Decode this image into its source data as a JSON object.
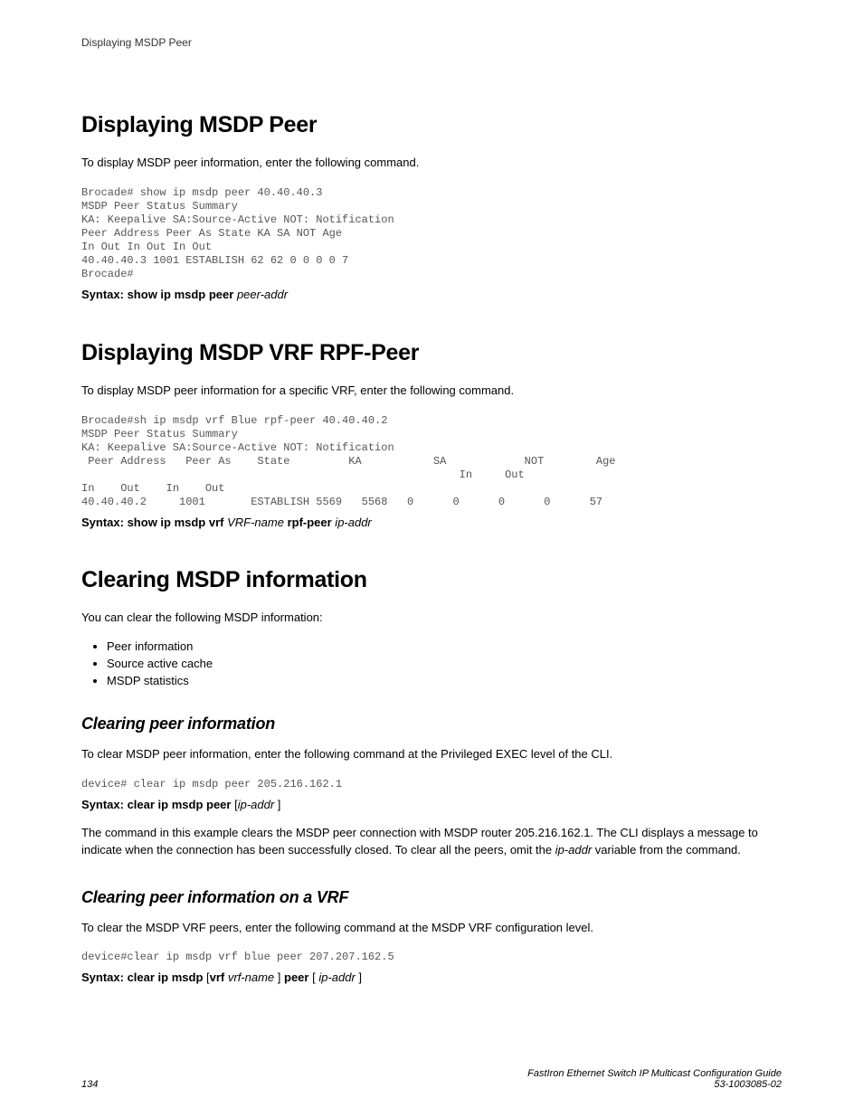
{
  "header": {
    "running": "Displaying MSDP Peer"
  },
  "sec1": {
    "title": "Displaying MSDP Peer",
    "intro": "To display MSDP peer information, enter the following command.",
    "code": "Brocade# show ip msdp peer 40.40.40.3\nMSDP Peer Status Summary\nKA: Keepalive SA:Source-Active NOT: Notification\nPeer Address Peer As State KA SA NOT Age\nIn Out In Out In Out\n40.40.40.3 1001 ESTABLISH 62 62 0 0 0 0 7\nBrocade#",
    "syntax_label": "Syntax: ",
    "syntax_cmd": "show ip msdp peer",
    "syntax_arg": " peer-addr"
  },
  "sec2": {
    "title": "Displaying MSDP VRF RPF-Peer",
    "intro": "To display MSDP peer information for a specific VRF, enter the following command.",
    "code": "Brocade#sh ip msdp vrf Blue rpf-peer 40.40.40.2\nMSDP Peer Status Summary\nKA: Keepalive SA:Source-Active NOT: Notification\n Peer Address   Peer As    State         KA           SA            NOT        Age\n                                                          In     Out\nIn    Out    In    Out\n40.40.40.2     1001       ESTABLISH 5569   5568   0      0      0      0      57",
    "syntax_label": "Syntax: ",
    "syntax_cmd_a": "show ip msdp vrf",
    "syntax_arg_a": " VRF-name",
    "syntax_cmd_b": " rpf-peer",
    "syntax_arg_b": " ip-addr"
  },
  "sec3": {
    "title": "Clearing MSDP information",
    "intro": "You can clear the following MSDP information:",
    "bullets": [
      "Peer information",
      "Source active cache",
      "MSDP statistics"
    ],
    "sub1": {
      "title": "Clearing peer information",
      "intro": "To clear MSDP peer information, enter the following command at the Privileged EXEC level of the CLI.",
      "code": "device# clear ip msdp peer 205.216.162.1",
      "syntax_label": "Syntax: ",
      "syntax_cmd": "clear ip msdp peer",
      "syntax_open": " [",
      "syntax_arg": "ip-addr",
      "syntax_close": " ]",
      "para_a": "The command in this example clears the MSDP peer connection with MSDP router 205.216.162.1. The CLI displays a message to indicate when the connection has been successfully closed. To clear all the peers, omit the ",
      "para_arg": "ip-addr",
      "para_b": " variable from the command."
    },
    "sub2": {
      "title": "Clearing peer information on a VRF",
      "intro": "To clear the MSDP VRF peers, enter the following command at the MSDP VRF configuration level.",
      "code": "device#clear ip msdp vrf blue peer 207.207.162.5",
      "syntax_label": "Syntax: ",
      "syntax_cmd_a": "clear ip msdp",
      "syntax_open1": " [",
      "syntax_cmd_b": "vrf",
      "syntax_arg_a": " vrf-name",
      "syntax_close1": " ] ",
      "syntax_cmd_c": "peer",
      "syntax_open2": " [ ",
      "syntax_arg_b": "ip-addr",
      "syntax_close2": " ]"
    }
  },
  "footer": {
    "page": "134",
    "guide": "FastIron Ethernet Switch IP Multicast Configuration Guide",
    "docnum": "53-1003085-02"
  }
}
